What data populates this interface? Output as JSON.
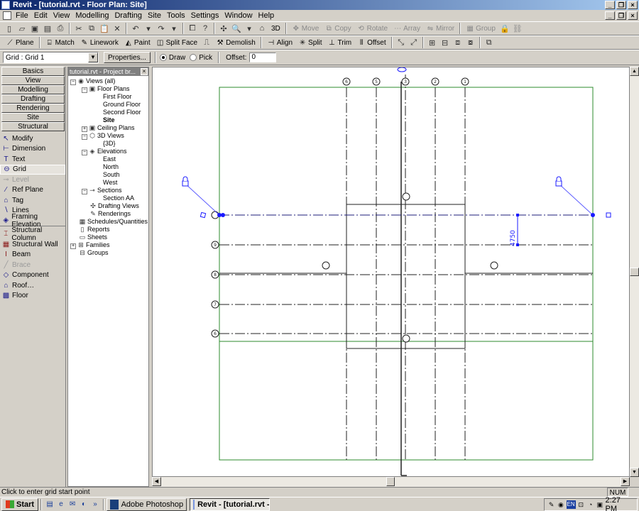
{
  "title": "Revit - [tutorial.rvt - Floor Plan: Site]",
  "window_buttons": [
    "_",
    "❐",
    "×"
  ],
  "menu": [
    "File",
    "Edit",
    "View",
    "Modelling",
    "Drafting",
    "Site",
    "Tools",
    "Settings",
    "Window",
    "Help"
  ],
  "toolbar1": {
    "view_3d": "3D",
    "move": "Move",
    "copy": "Copy",
    "rotate": "Rotate",
    "array": "Array",
    "mirror": "Mirror",
    "group": "Group"
  },
  "toolbar2": {
    "plane": "Plane",
    "match": "Match",
    "linework": "Linework",
    "paint": "Paint",
    "split_face": "Split Face",
    "demolish": "Demolish",
    "align": "Align",
    "split": "Split",
    "trim": "Trim",
    "offset": "Offset"
  },
  "options_bar": {
    "type_selector": "Grid : Grid 1",
    "properties": "Properties...",
    "draw": "Draw",
    "pick": "Pick",
    "offset_label": "Offset:",
    "offset_value": "0"
  },
  "design_bar": {
    "tabs": [
      "Basics",
      "View",
      "Modelling",
      "Drafting",
      "Rendering",
      "Site",
      "Structural"
    ],
    "items": [
      {
        "label": "Modify",
        "icon": "↖"
      },
      {
        "label": "Dimension",
        "icon": "⊢"
      },
      {
        "label": "Text",
        "icon": "T"
      },
      {
        "label": "Grid",
        "icon": "⊖"
      },
      {
        "label": "Level",
        "icon": "⊸"
      },
      {
        "label": "Ref Plane",
        "icon": "∕"
      },
      {
        "label": "Tag",
        "icon": "⌂"
      },
      {
        "label": "Lines",
        "icon": "∖"
      },
      {
        "label": "Framing Elevation",
        "icon": "◈"
      },
      {
        "label": "Structural Column",
        "icon": "⌶"
      },
      {
        "label": "Structural Wall",
        "icon": "▦"
      },
      {
        "label": "Beam",
        "icon": "I"
      },
      {
        "label": "Brace",
        "icon": "╱"
      },
      {
        "label": "Component",
        "icon": "◇"
      },
      {
        "label": "Roof…",
        "icon": "⌂"
      },
      {
        "label": "Floor",
        "icon": "▩"
      }
    ]
  },
  "project_browser": {
    "title": "tutorial.rvt - Project br...",
    "nodes": {
      "views": "Views (all)",
      "floor_plans": "Floor Plans",
      "first_floor": "First Floor",
      "ground_floor": "Ground Floor",
      "second_floor": "Second Floor",
      "site": "Site",
      "ceiling_plans": "Ceiling Plans",
      "views_3d": "3D Views",
      "view_3d_item": "{3D}",
      "elevations": "Elevations",
      "east": "East",
      "north": "North",
      "south": "South",
      "west": "West",
      "sections": "Sections",
      "section_aa": "Section AA",
      "drafting_views": "Drafting Views",
      "renderings": "Renderings",
      "schedules": "Schedules/Quantities",
      "reports": "Reports",
      "sheets": "Sheets",
      "families": "Families",
      "groups": "Groups"
    }
  },
  "drawing": {
    "dimension": "4750",
    "vertical_grid_labels": [
      "6",
      "5",
      "3",
      "2",
      "1"
    ],
    "horizontal_grid_labels": [
      "9",
      "8",
      "7",
      "6"
    ]
  },
  "status": {
    "message": "Click to enter grid start point",
    "num": "NUM"
  },
  "taskbar": {
    "start": "Start",
    "apps": [
      "Adobe Photoshop",
      "Revit - [tutorial.rvt -..."
    ],
    "lang": "EN",
    "clock": "2:27 PM"
  },
  "colors": {
    "title_gradient_start": "#0a246a",
    "title_gradient_end": "#a6caf0",
    "selection_blue": "#1a1aff",
    "site_green": "#2e8b2e"
  }
}
